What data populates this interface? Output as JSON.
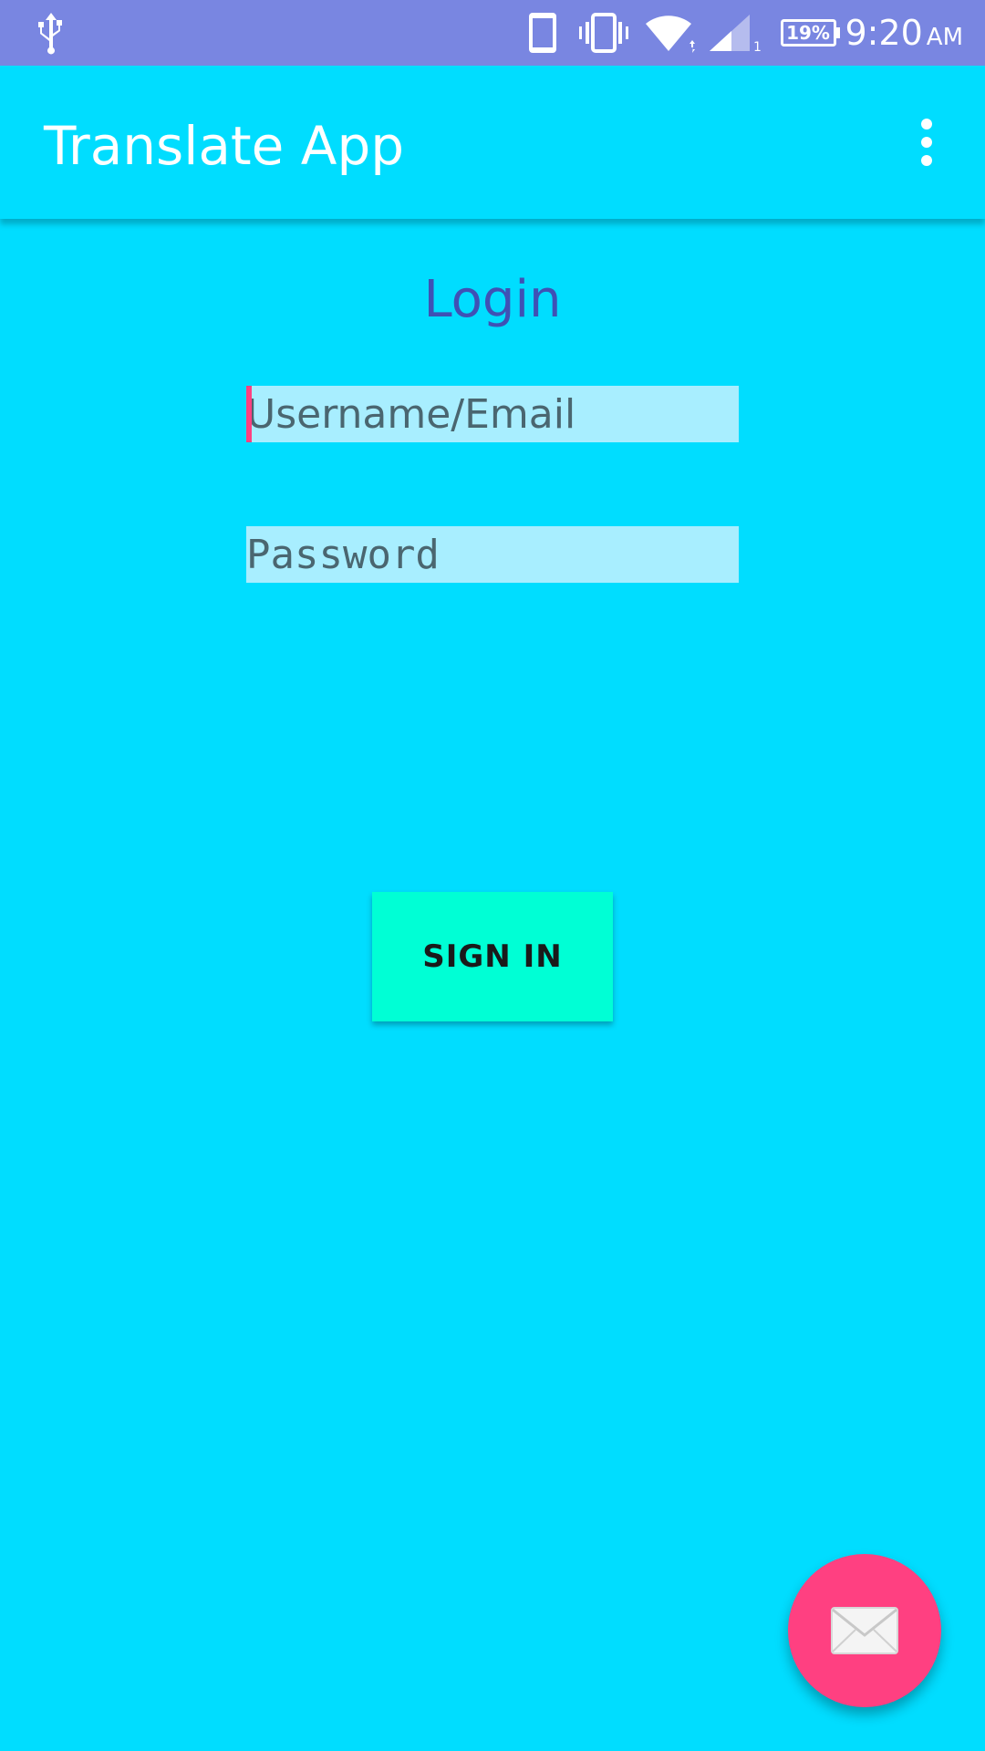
{
  "status_bar": {
    "battery_level": "19%",
    "time": "9:20",
    "ampm": "AM",
    "icons": [
      "usb-icon",
      "screen-icon",
      "vibrate-icon",
      "wifi-icon",
      "signal-icon",
      "battery-icon"
    ]
  },
  "app_bar": {
    "title": "Translate App",
    "menu_icon": "more-vert-icon"
  },
  "login": {
    "title": "Login",
    "username_placeholder": "Username/Email",
    "password_placeholder": "Password",
    "sign_in_label": "SIGN IN"
  },
  "fab": {
    "icon": "email-icon"
  },
  "colors": {
    "status_bar": "#7986E1",
    "background": "#00DDFF",
    "title_text": "#3F51B5",
    "input_background": "#A8EEFF",
    "button": "#00FFD5",
    "accent": "#FF4081"
  }
}
